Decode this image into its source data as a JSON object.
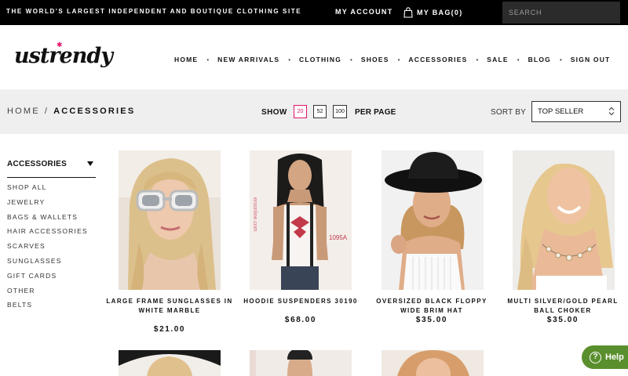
{
  "topbar": {
    "tagline": "THE WORLD'S LARGEST INDEPENDENT AND BOUTIQUE CLOTHING SITE",
    "account": "MY ACCOUNT",
    "bag": "MY BAG(0)",
    "search_placeholder": "SEARCH"
  },
  "header": {
    "logo": "ustrendy",
    "nav": [
      "HOME",
      "NEW ARRIVALS",
      "CLOTHING",
      "SHOES",
      "ACCESSORIES",
      "SALE",
      "BLOG",
      "SIGN OUT"
    ]
  },
  "toolbar": {
    "breadcrumb": {
      "home": "HOME",
      "separator": "/",
      "current": "ACCESSORIES"
    },
    "show_label": "SHOW",
    "per_page_options": [
      "20",
      "52",
      "100"
    ],
    "per_page_selected": "20",
    "per_page_label": "PER PAGE",
    "sort_label": "SORT BY",
    "sort_value": "TOP SELLER"
  },
  "sidebar": {
    "title": "ACCESSORIES",
    "items": [
      "SHOP ALL",
      "JEWELRY",
      "BAGS & WALLETS",
      "HAIR ACCESSORIES",
      "SCARVES",
      "SUNGLASSES",
      "GIFT CARDS",
      "OTHER",
      "BELTS"
    ]
  },
  "products": [
    {
      "name": "LARGE FRAME SUNGLASSES IN WHITE MARBLE",
      "price": "$21.00"
    },
    {
      "name": "HOODIE SUSPENDERS 30190",
      "price": "$68.00",
      "photo_text": {
        "watermark": "ersonline.com",
        "tag": "1095A"
      }
    },
    {
      "name": "OVERSIZED BLACK FLOPPY WIDE BRIM HAT",
      "price": "$35.00"
    },
    {
      "name": "MULTI SILVER/GOLD PEARL BALL CHOKER",
      "price": "$35.00"
    }
  ],
  "help": {
    "label": "Help",
    "icon_char": "?"
  },
  "colors": {
    "accent": "#e2156b",
    "topbar": "#000000",
    "toolbar": "#efefef",
    "help": "#5a8f2e"
  }
}
